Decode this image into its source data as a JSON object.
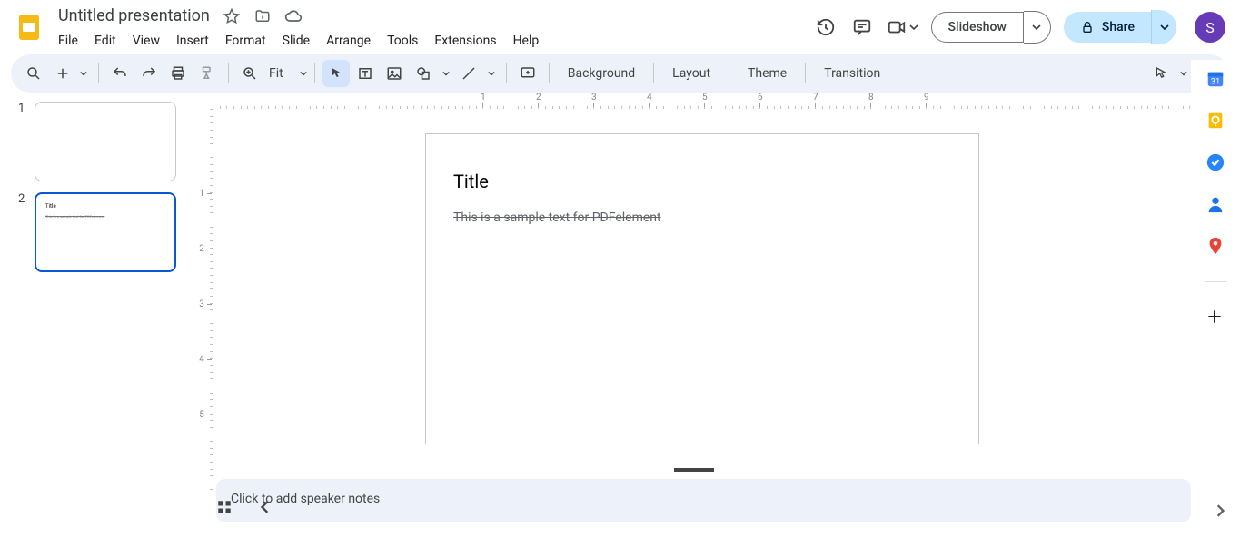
{
  "header": {
    "title": "Untitled presentation",
    "menus": [
      "File",
      "Edit",
      "View",
      "Insert",
      "Format",
      "Slide",
      "Arrange",
      "Tools",
      "Extensions",
      "Help"
    ],
    "slideshow_label": "Slideshow",
    "share_label": "Share",
    "avatar_initial": "S"
  },
  "toolbar": {
    "zoom_label": "Fit",
    "background_label": "Background",
    "layout_label": "Layout",
    "theme_label": "Theme",
    "transition_label": "Transition"
  },
  "ruler": {
    "h": [
      "1",
      "2",
      "3",
      "4",
      "5",
      "6",
      "7",
      "8",
      "9"
    ],
    "v": [
      "1",
      "2",
      "3",
      "4",
      "5"
    ]
  },
  "slides": [
    {
      "number": "1",
      "title": "",
      "body": ""
    },
    {
      "number": "2",
      "title": "Title",
      "body": "This is a sample text for PDFelement"
    }
  ],
  "current_slide": {
    "title": "Title",
    "body": "This is a sample text for PDFelement"
  },
  "notes_placeholder": "Click to add speaker notes"
}
